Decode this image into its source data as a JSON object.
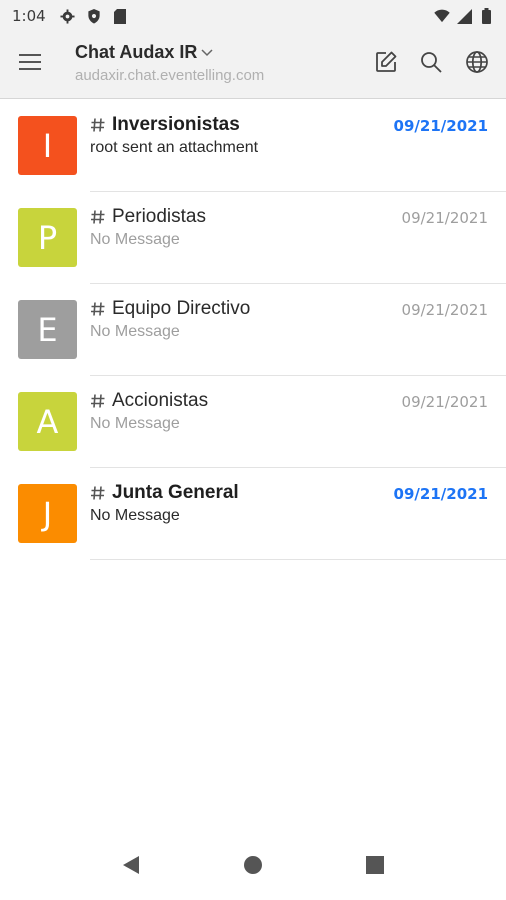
{
  "status_bar": {
    "time": "1:04",
    "left_icons": [
      "gear-icon",
      "shield-icon",
      "sd-card-icon"
    ],
    "right_icons": [
      "wifi-icon",
      "signal-icon",
      "battery-icon"
    ]
  },
  "app_bar": {
    "title": "Chat Audax IR",
    "subtitle": "audaxir.chat.eventelling.com",
    "actions": [
      "edit-icon",
      "search-icon",
      "globe-icon"
    ]
  },
  "colors": {
    "accent": "#1d74f5",
    "avatar_I": "#f4511e",
    "avatar_P": "#c8d43c",
    "avatar_E": "#9e9e9e",
    "avatar_A": "#c8d43c",
    "avatar_J": "#fb8c00"
  },
  "rooms": [
    {
      "initial": "I",
      "name": "Inversionistas",
      "last_message": "root sent an attachment",
      "date": "09/21/2021",
      "unread": true
    },
    {
      "initial": "P",
      "name": "Periodistas",
      "last_message": "No Message",
      "date": "09/21/2021",
      "unread": false
    },
    {
      "initial": "E",
      "name": "Equipo Directivo",
      "last_message": "No Message",
      "date": "09/21/2021",
      "unread": false
    },
    {
      "initial": "A",
      "name": "Accionistas",
      "last_message": "No Message",
      "date": "09/21/2021",
      "unread": false
    },
    {
      "initial": "J",
      "name": "Junta General",
      "last_message": "No Message",
      "date": "09/21/2021",
      "unread": true
    }
  ],
  "nav_bar": [
    "back-icon",
    "home-icon",
    "recents-icon"
  ]
}
